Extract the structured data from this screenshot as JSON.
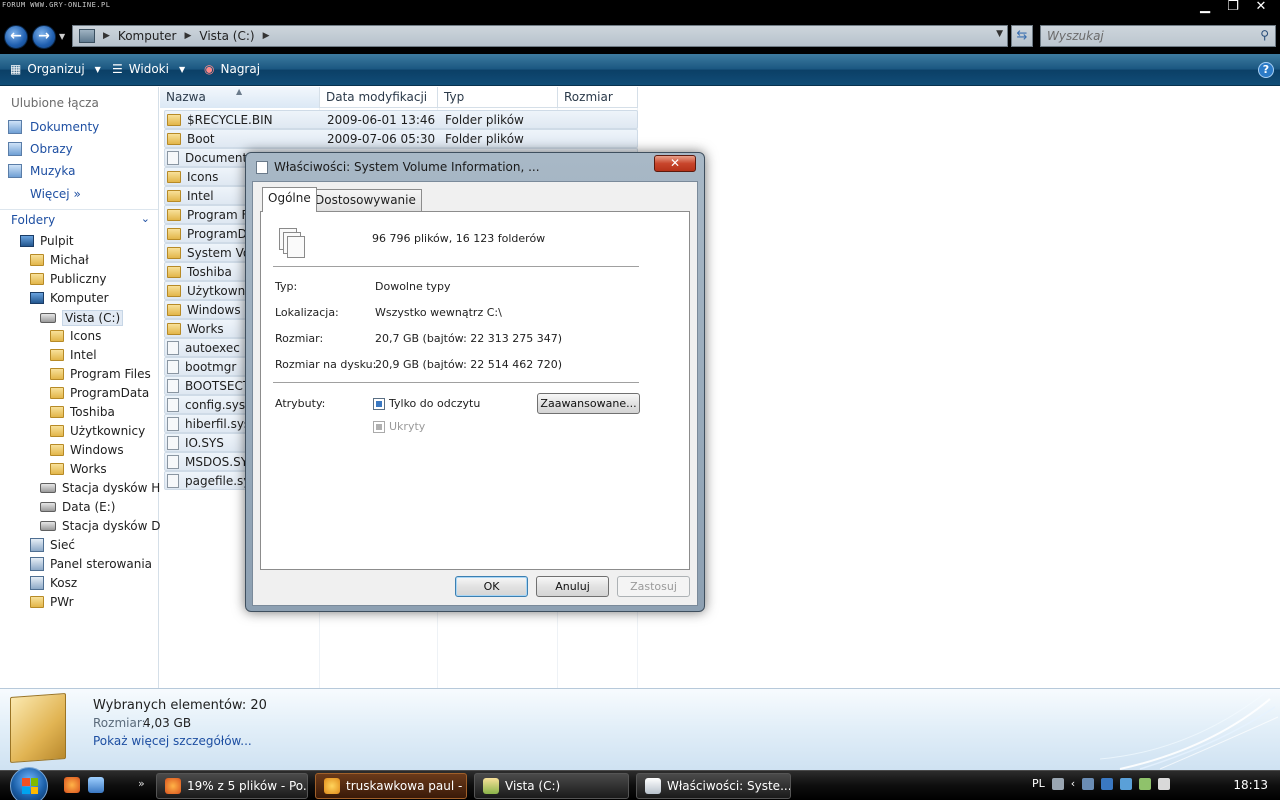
{
  "watermark": "FORUM WWW.GRY-ONLINE.PL",
  "address": {
    "crumbs": [
      "Komputer",
      "Vista (C:)"
    ],
    "search_placeholder": "Wyszukaj"
  },
  "toolbar": {
    "organize": "Organizuj",
    "views": "Widoki",
    "burn": "Nagraj"
  },
  "nav": {
    "favorites_title": "Ulubione łącza",
    "favorites": [
      "Dokumenty",
      "Obrazy",
      "Muzyka"
    ],
    "more": "Więcej",
    "folders_title": "Foldery",
    "tree": [
      {
        "label": "Pulpit",
        "indent": 0,
        "icon": "desktop-icon"
      },
      {
        "label": "Michał",
        "indent": 1,
        "icon": "user-folder-icon"
      },
      {
        "label": "Publiczny",
        "indent": 1,
        "icon": "folder-icon"
      },
      {
        "label": "Komputer",
        "indent": 1,
        "icon": "computer-icon"
      },
      {
        "label": "Vista (C:)",
        "indent": 2,
        "icon": "drive-icon",
        "selected": true
      },
      {
        "label": "Icons",
        "indent": 3,
        "icon": "folder-icon"
      },
      {
        "label": "Intel",
        "indent": 3,
        "icon": "folder-icon"
      },
      {
        "label": "Program Files",
        "indent": 3,
        "icon": "folder-icon"
      },
      {
        "label": "ProgramData",
        "indent": 3,
        "icon": "folder-icon"
      },
      {
        "label": "Toshiba",
        "indent": 3,
        "icon": "folder-icon"
      },
      {
        "label": "Użytkownicy",
        "indent": 3,
        "icon": "folder-icon"
      },
      {
        "label": "Windows",
        "indent": 3,
        "icon": "folder-icon"
      },
      {
        "label": "Works",
        "indent": 3,
        "icon": "folder-icon"
      },
      {
        "label": "Stacja dysków HD",
        "indent": 2,
        "icon": "drive-icon"
      },
      {
        "label": "Data (E:)",
        "indent": 2,
        "icon": "drive-icon"
      },
      {
        "label": "Stacja dysków DVI",
        "indent": 2,
        "icon": "dvd-drive-icon"
      },
      {
        "label": "Sieć",
        "indent": 1,
        "icon": "network-icon"
      },
      {
        "label": "Panel sterowania",
        "indent": 1,
        "icon": "control-panel-icon"
      },
      {
        "label": "Kosz",
        "indent": 1,
        "icon": "recycle-bin-icon"
      },
      {
        "label": "PWr",
        "indent": 1,
        "icon": "folder-icon"
      }
    ]
  },
  "list": {
    "columns": [
      "Nazwa",
      "Data modyfikacji",
      "Typ",
      "Rozmiar"
    ],
    "rows": [
      {
        "name": "$RECYCLE.BIN",
        "date": "2009-06-01 13:46",
        "type": "Folder plików",
        "kind": "folder"
      },
      {
        "name": "Boot",
        "date": "2009-07-06 05:30",
        "type": "Folder plików",
        "kind": "folder"
      },
      {
        "name": "Documents",
        "date": "",
        "type": "",
        "kind": "shortcut"
      },
      {
        "name": "Icons",
        "date": "",
        "type": "",
        "kind": "folder"
      },
      {
        "name": "Intel",
        "date": "",
        "type": "",
        "kind": "folder"
      },
      {
        "name": "Program Fi",
        "date": "",
        "type": "",
        "kind": "folder"
      },
      {
        "name": "ProgramDa",
        "date": "",
        "type": "",
        "kind": "folder"
      },
      {
        "name": "System Vol",
        "date": "",
        "type": "",
        "kind": "folder"
      },
      {
        "name": "Toshiba",
        "date": "",
        "type": "",
        "kind": "folder"
      },
      {
        "name": "Użytkownic",
        "date": "",
        "type": "",
        "kind": "folder"
      },
      {
        "name": "Windows",
        "date": "",
        "type": "",
        "kind": "folder"
      },
      {
        "name": "Works",
        "date": "",
        "type": "",
        "kind": "folder"
      },
      {
        "name": "autoexec",
        "date": "",
        "type": "",
        "kind": "file"
      },
      {
        "name": "bootmgr",
        "date": "",
        "type": "",
        "kind": "file"
      },
      {
        "name": "BOOTSECT",
        "date": "",
        "type": "",
        "kind": "file"
      },
      {
        "name": "config.sys",
        "date": "",
        "type": "",
        "kind": "file"
      },
      {
        "name": "hiberfil.sys",
        "date": "",
        "type": "",
        "kind": "file"
      },
      {
        "name": "IO.SYS",
        "date": "",
        "type": "",
        "kind": "file"
      },
      {
        "name": "MSDOS.SYS",
        "date": "",
        "type": "",
        "kind": "file"
      },
      {
        "name": "pagefile.sys",
        "date": "",
        "type": "",
        "kind": "file"
      }
    ]
  },
  "details": {
    "title": "Wybranych elementów: 20",
    "size_label": "Rozmiar:",
    "size_value": "4,03 GB",
    "more_link": "Pokaż więcej szczegółów..."
  },
  "dialog": {
    "title": "Właściwości: System Volume Information, ...",
    "tabs": [
      "Ogólne",
      "Dostosowywanie"
    ],
    "count": "96 796 plików, 16 123 folderów",
    "type_label": "Typ:",
    "type_value": "Dowolne typy",
    "location_label": "Lokalizacja:",
    "location_value": "Wszystko wewnątrz C:\\",
    "size_label": "Rozmiar:",
    "size_value": "20,7 GB (bajtów: 22 313 275 347)",
    "disk_size_label": "Rozmiar na dysku:",
    "disk_size_value": "20,9 GB (bajtów: 22 514 462 720)",
    "attributes_label": "Atrybuty:",
    "readonly_label": "Tylko do odczytu",
    "hidden_label": "Ukryty",
    "advanced_button": "Zaawansowane...",
    "ok_button": "OK",
    "cancel_button": "Anuluj",
    "apply_button": "Zastosuj"
  },
  "taskbar": {
    "buttons": [
      {
        "label": "19% z 5 plików - Po...",
        "icon": "firefox-icon",
        "active": false
      },
      {
        "label": "truskawkowa paul - ...",
        "icon": "messenger-icon",
        "active": true
      },
      {
        "label": "Vista (C:)",
        "icon": "explorer-icon",
        "active": false
      },
      {
        "label": "Właściwości: Syste...",
        "icon": "properties-icon",
        "active": false
      }
    ],
    "language": "PL",
    "clock": "18:13"
  },
  "colors": {
    "toolbar": "#114d77",
    "link": "#1e4fa2",
    "taskbar": "#0e0e0e"
  }
}
